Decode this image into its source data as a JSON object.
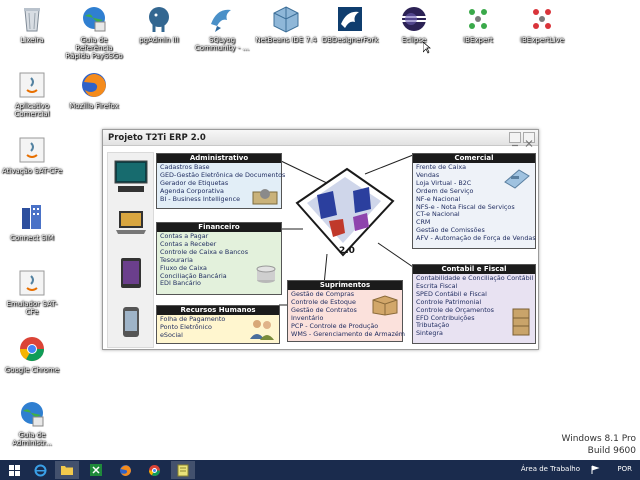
{
  "desktop_icons": [
    {
      "id": "lixeira",
      "label": "Lixeira"
    },
    {
      "id": "guia",
      "label": "Guia de Referência Rápida PaySSGo"
    },
    {
      "id": "pgadmin",
      "label": "pgAdmin III"
    },
    {
      "id": "sqlyog",
      "label": "SQLyog Community - ..."
    },
    {
      "id": "netbeans",
      "label": "NetBeans IDE 7.4"
    },
    {
      "id": "dbdesigner",
      "label": "DBDesignerFork"
    },
    {
      "id": "eclipse",
      "label": "Eclipse"
    },
    {
      "id": "ibexpert",
      "label": "IBExpert"
    },
    {
      "id": "ibexpertlive",
      "label": "IBExpertLive"
    },
    {
      "id": "aplicativo",
      "label": "Aplicativo Comercial"
    },
    {
      "id": "firefox",
      "label": "Mozilla Firefox"
    },
    {
      "id": "ativacao",
      "label": "Ativação SAT-CFe"
    },
    {
      "id": "connect",
      "label": "Connect SIM"
    },
    {
      "id": "emulador",
      "label": "Emulador SAT-CFe"
    },
    {
      "id": "chrome",
      "label": "Google Chrome"
    },
    {
      "id": "guiaadmin",
      "label": "Guia de Administr..."
    }
  ],
  "window": {
    "title": "Projeto T2Ti ERP 2.0",
    "logo_text": "2.0"
  },
  "panels": {
    "administrativo": {
      "title": "Administrativo",
      "items": [
        "Cadastros Base",
        "GED-Gestão Eletrônica de Documentos",
        "Gerador de Etiquetas",
        "Agenda Corporativa",
        "BI - Business Intelligence"
      ]
    },
    "financeiro": {
      "title": "Financeiro",
      "items": [
        "Contas a Pagar",
        "Contas a Receber",
        "Controle de Caixa e Bancos",
        "Tesouraria",
        "Fluxo de Caixa",
        "Conciliação Bancária",
        "EDI Bancário"
      ]
    },
    "rh": {
      "title": "Recursos Humanos",
      "items": [
        "Folha de Pagamento",
        "Ponto Eletrônico",
        "eSocial"
      ]
    },
    "suprimentos": {
      "title": "Suprimentos",
      "items": [
        "Gestão de Compras",
        "Controle de Estoque",
        "Gestão de Contratos",
        "Inventário",
        "PCP - Controle de Produção",
        "WMS - Gerenciamento de Armazém"
      ]
    },
    "comercial": {
      "title": "Comercial",
      "items": [
        "Frente de Caixa",
        "Vendas",
        "Loja Virtual - B2C",
        "Ordem de Serviço",
        "NF-e Nacional",
        "NFS-e - Nota Fiscal de Serviços",
        "CT-e Nacional",
        "CRM",
        "Gestão de Comissões",
        "AFV - Automação de Força de Vendas"
      ]
    },
    "contabil": {
      "title": "Contabil e Fiscal",
      "items": [
        "Contabilidade e Conciliação Contábil",
        "Escrita Fiscal",
        "SPED Contábil e Fiscal",
        "Controle Patrimonial",
        "Controle de Orçamentos",
        "EFD Contribuições",
        "Tributação",
        "Sintegra"
      ]
    }
  },
  "taskbar": {
    "tray_label": "Área de Trabalho",
    "language": "POR"
  },
  "watermark": {
    "line1": "Windows 8.1 Pro",
    "line2": "Build 9600"
  }
}
